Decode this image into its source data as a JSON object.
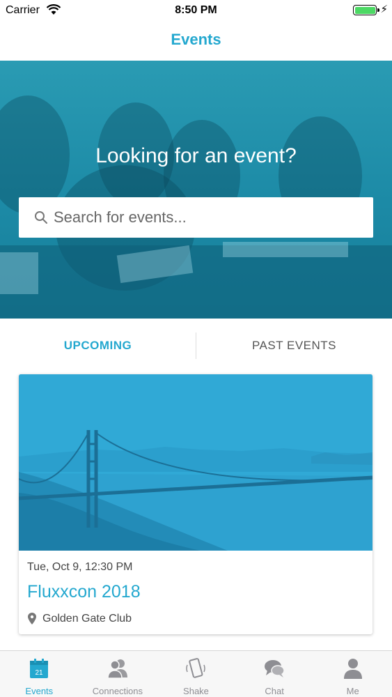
{
  "status_bar": {
    "carrier": "Carrier",
    "time": "8:50 PM",
    "battery_level": 1.0
  },
  "nav": {
    "title": "Events"
  },
  "hero": {
    "heading": "Looking for an event?",
    "search": {
      "placeholder": "Search for events...",
      "value": "",
      "icon": "search-icon"
    }
  },
  "tabs": {
    "upcoming": "UPCOMING",
    "past": "PAST EVENTS",
    "selected": "upcoming"
  },
  "events": [
    {
      "date": "Tue, Oct 9, 12:30 PM",
      "title": "Fluxxcon 2018",
      "location": "Golden Gate Club",
      "location_icon": "map-pin-icon"
    }
  ],
  "tab_bar": {
    "items": [
      {
        "label": "Events",
        "icon": "calendar-icon",
        "badge": "21",
        "active": true
      },
      {
        "label": "Connections",
        "icon": "people-icon",
        "active": false
      },
      {
        "label": "Shake",
        "icon": "phone-shake-icon",
        "active": false
      },
      {
        "label": "Chat",
        "icon": "chat-bubbles-icon",
        "active": false
      },
      {
        "label": "Me",
        "icon": "person-icon",
        "active": false
      }
    ]
  },
  "colors": {
    "accent": "#24a8cf",
    "hero_overlay": "#1c8aa6",
    "card_image": "#30a9d6",
    "inactive": "#8e8e93"
  }
}
